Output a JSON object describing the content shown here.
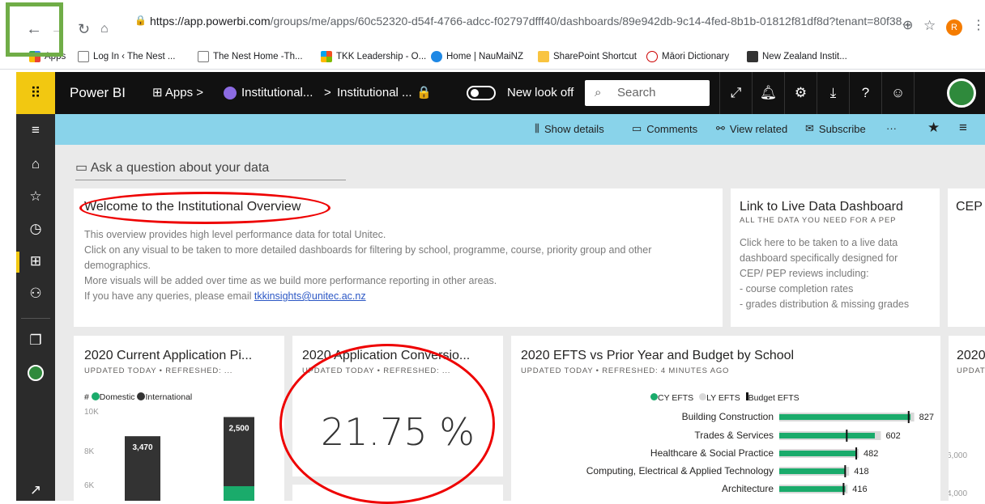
{
  "browser": {
    "url_host": "https://app.powerbi.com",
    "url_path": "/groups/me/apps/60c52320-d54f-4766-adcc-f02797dfff40/dashboards/89e942db-9c14-4fed-8b1b-01812f81df8d?tenant=80f38...",
    "profile_initial": "R",
    "bookmarks": [
      "Apps",
      "Log In ‹ The Nest ...",
      "The Nest Home -Th...",
      "TKK Leadership - O...",
      "Home | NauMaiNZ",
      "SharePoint Shortcut",
      "Māori Dictionary",
      "New Zealand Instit..."
    ]
  },
  "pbi_header": {
    "brand": "Power BI",
    "apps": "Apps",
    "app_name": "Institutional...",
    "dashboard_name": "Institutional ...",
    "toggle_label": "New look off",
    "search_placeholder": "Search"
  },
  "actions": {
    "show_details": "Show details",
    "comments": "Comments",
    "view_related": "View related",
    "subscribe": "Subscribe",
    "more": "···"
  },
  "qna": "Ask a question about your data",
  "welcome": {
    "title": "Welcome to the Institutional Overview",
    "lines": [
      "This overview provides high level performance data for total Unitec.",
      "Click on any visual to be taken to more detailed dashboards for filtering by school, programme, course, priority group and other demographics.",
      "More visuals will be added over time as we build more performance reporting in other areas.",
      "If you have any queries, please email "
    ],
    "email": "tkkinsights@unitec.ac.nz"
  },
  "live": {
    "title": "Link to Live Data Dashboard",
    "subtitle": "ALL THE DATA YOU NEED FOR A PEP",
    "lines": [
      "Click here to be taken to a live data",
      "dashboard specifically designed for",
      "CEP/ PEP reviews including:",
      "- course completion rates",
      "- grades distribution & missing grades"
    ]
  },
  "cep_title": "CEP (",
  "tile_app": {
    "title": "2020 Current Application Pi...",
    "subtitle": "UPDATED TODAY  •  REFRESHED: ...",
    "legend_hash": "#",
    "legend": [
      "Domestic",
      "International"
    ]
  },
  "tile_conv": {
    "title": "2020 Application Conversio...",
    "subtitle": "UPDATED TODAY  •  REFRESHED: ...",
    "kpi": "21.75 %"
  },
  "tile_efts": {
    "title": "2020 EFTS vs Prior Year and Budget by School",
    "subtitle": "UPDATED TODAY  •  REFRESHED: 4 MINUTES AGO",
    "legend": [
      "CY EFTS",
      "LY EFTS",
      "Budget EFTS"
    ]
  },
  "tile_right": {
    "title": "2020",
    "subtitle": "UPDAT",
    "ticks": [
      "6,000",
      "4,000"
    ]
  },
  "colors": {
    "accent_green": "#01b8aa",
    "bar_green": "#1aab6b",
    "bar_dark": "#333333",
    "yellow": "#f2c811",
    "cyan_bar": "#89d3ea"
  },
  "chart_data": [
    {
      "type": "bar",
      "title": "2020 Current Application Pi...",
      "series": [
        {
          "name": "Domestic",
          "values": [
            null,
            null
          ]
        },
        {
          "name": "International",
          "values": [
            3470,
            2500
          ]
        }
      ],
      "categories": [
        "",
        ""
      ],
      "data_labels": [
        "3,470",
        "2,500"
      ],
      "y_ticks": [
        "10K",
        "8K",
        "6K"
      ],
      "ylim": [
        0,
        10000
      ]
    },
    {
      "type": "bar",
      "title": "2020 EFTS vs Prior Year and Budget by School",
      "categories": [
        "Building Construction",
        "Trades & Services",
        "Healthcare & Social Practice",
        "Computing, Electrical & Applied Technology",
        "Architecture"
      ],
      "series": [
        {
          "name": "CY EFTS",
          "values": [
            827,
            602,
            482,
            418,
            416
          ]
        },
        {
          "name": "LY EFTS",
          "values": [
            850,
            640,
            500,
            440,
            430
          ]
        },
        {
          "name": "Budget EFTS",
          "values": [
            810,
            420,
            480,
            410,
            400
          ]
        }
      ],
      "data_labels": [
        "827",
        "602",
        "482",
        "418",
        "416"
      ],
      "xlim": [
        0,
        900
      ]
    }
  ]
}
